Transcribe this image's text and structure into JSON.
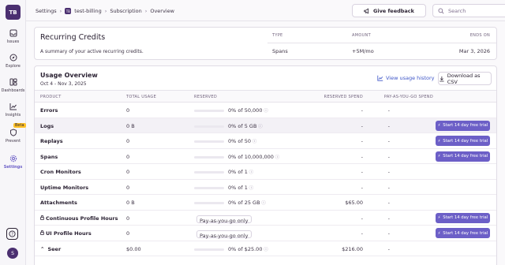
{
  "sidebar": {
    "logo": "TB",
    "items": [
      {
        "label": "Issues",
        "icon": "inbox-icon"
      },
      {
        "label": "Explore",
        "icon": "compass-icon"
      },
      {
        "label": "Dashboards",
        "icon": "dashboard-icon"
      },
      {
        "label": "Insights",
        "icon": "chart-icon"
      },
      {
        "label": "Prevent",
        "icon": "shield-icon"
      },
      {
        "label": "Settings",
        "icon": "gear-icon"
      }
    ],
    "beta_badge": "Beta",
    "avatar": "S"
  },
  "breadcrumb": {
    "items": [
      "Settings",
      "test-billing",
      "Subscription",
      "Overview"
    ],
    "org_badge": "TB"
  },
  "header": {
    "feedback_label": "Give feedback",
    "search_placeholder": "Search"
  },
  "recurring_credits": {
    "title": "Recurring Credits",
    "subtitle": "A summary of your active recurring credits.",
    "columns": [
      "TYPE",
      "AMOUNT",
      "ENDS ON"
    ],
    "row": {
      "type": "Spans",
      "amount": "+5M/mo",
      "ends_on": "Mar 3, 2026"
    }
  },
  "usage_overview": {
    "title": "Usage Overview",
    "period": "Oct 4 - Nov 3, 2025",
    "view_history_label": "View usage history",
    "download_label": "Download as CSV",
    "columns": [
      "PRODUCT",
      "TOTAL USAGE",
      "RESERVED",
      "RESERVED SPEND",
      "PAY-AS-YOU-GO SPEND"
    ],
    "trial_label": "Start 14 day free trial",
    "paygo_only_label": "Pay-as-you-go only",
    "rows": [
      {
        "product": "Errors",
        "usage": "0",
        "reserved": "0% of 50,000",
        "reserved_spend": "-",
        "payg_spend": "-",
        "trial": false
      },
      {
        "product": "Logs",
        "usage": "0 B",
        "reserved": "0% of 5 GB",
        "reserved_spend": "-",
        "payg_spend": "-",
        "trial": true
      },
      {
        "product": "Replays",
        "usage": "0",
        "reserved": "0% of 50",
        "reserved_spend": "-",
        "payg_spend": "-",
        "trial": true
      },
      {
        "product": "Spans",
        "usage": "0",
        "reserved": "0% of 10,000,000",
        "reserved_spend": "-",
        "payg_spend": "-",
        "trial": true
      },
      {
        "product": "Cron Monitors",
        "usage": "0",
        "reserved": "0% of 1",
        "reserved_spend": "-",
        "payg_spend": "-",
        "trial": false
      },
      {
        "product": "Uptime Monitors",
        "usage": "0",
        "reserved": "0% of 1",
        "reserved_spend": "-",
        "payg_spend": "-",
        "trial": false
      },
      {
        "product": "Attachments",
        "usage": "0 B",
        "reserved": "0% of 25 GB",
        "reserved_spend": "$65.00",
        "payg_spend": "-",
        "trial": false
      },
      {
        "product": "Continuous Profile Hours",
        "usage": "0",
        "reserved": "",
        "paygo_only": true,
        "reserved_spend": "-",
        "payg_spend": "-",
        "trial": true,
        "locked": true
      },
      {
        "product": "UI Profile Hours",
        "usage": "0",
        "reserved": "",
        "paygo_only": true,
        "reserved_spend": "-",
        "payg_spend": "-",
        "trial": true,
        "locked": true
      },
      {
        "product": "Seer",
        "usage": "$0.00",
        "reserved": "0% of $25.00",
        "reserved_spend": "$216.00",
        "payg_spend": "-",
        "trial": false,
        "expandable": true
      }
    ]
  },
  "colors": {
    "accent": "#6c5fc7",
    "brand": "#4b2f70",
    "link": "#3d55c7",
    "beta": "#ffc227"
  }
}
